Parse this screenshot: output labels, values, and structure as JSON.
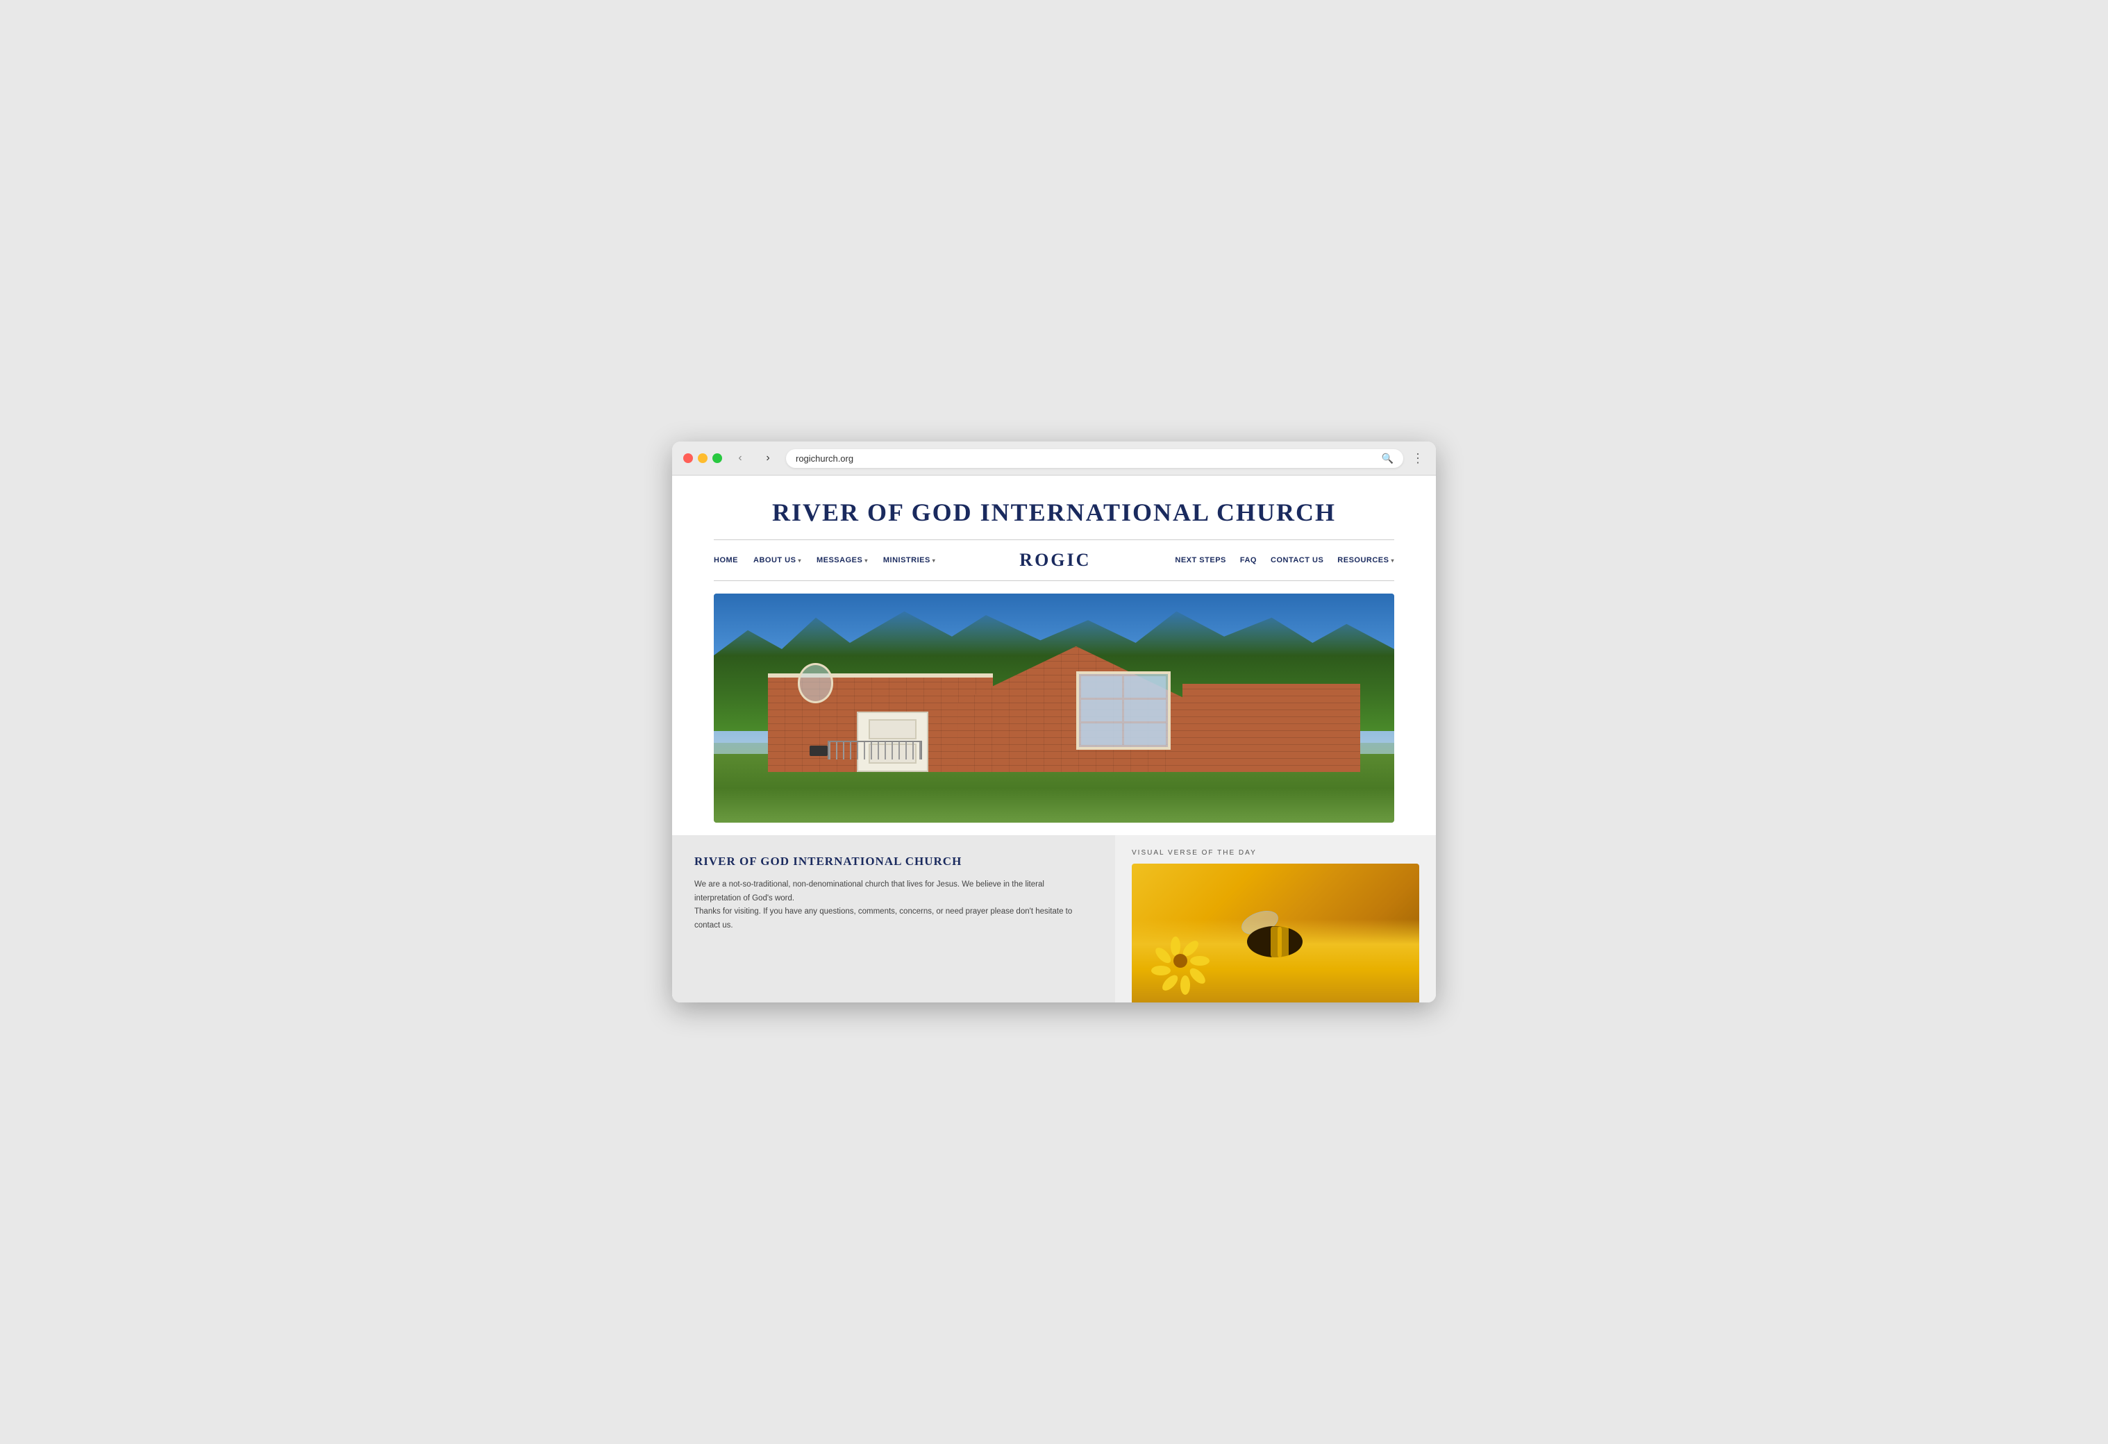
{
  "browser": {
    "url": "rogichurch.org",
    "search_placeholder": "Search"
  },
  "site": {
    "title": "RIVER OF GOD INTERNATIONAL CHURCH",
    "logo": "ROGIC",
    "nav_left": [
      {
        "id": "home",
        "label": "HOME",
        "active": true,
        "has_dropdown": false
      },
      {
        "id": "about-us",
        "label": "ABOUT US",
        "active": false,
        "has_dropdown": true
      },
      {
        "id": "messages",
        "label": "MESSAGES",
        "active": false,
        "has_dropdown": true
      },
      {
        "id": "ministries",
        "label": "MINISTRIES",
        "active": false,
        "has_dropdown": true
      }
    ],
    "nav_right": [
      {
        "id": "next-steps",
        "label": "NEXT STEPS",
        "active": false,
        "has_dropdown": false
      },
      {
        "id": "faq",
        "label": "FAQ",
        "active": false,
        "has_dropdown": false
      },
      {
        "id": "contact-us",
        "label": "CONTACT US",
        "active": false,
        "has_dropdown": false
      },
      {
        "id": "resources",
        "label": "RESOURCES",
        "active": false,
        "has_dropdown": true
      }
    ],
    "info_section": {
      "title": "RIVER OF GOD INTERNATIONAL CHURCH",
      "paragraph1": "We are a not-so-traditional, non-denominational church that lives for Jesus. We believe in the literal interpretation of God's word.",
      "paragraph2": "Thanks for visiting. If you have any questions, comments, concerns, or need prayer please don't hesitate to contact us."
    },
    "visual_verse": {
      "label": "VISUAL VERSE OF THE DAY"
    }
  }
}
